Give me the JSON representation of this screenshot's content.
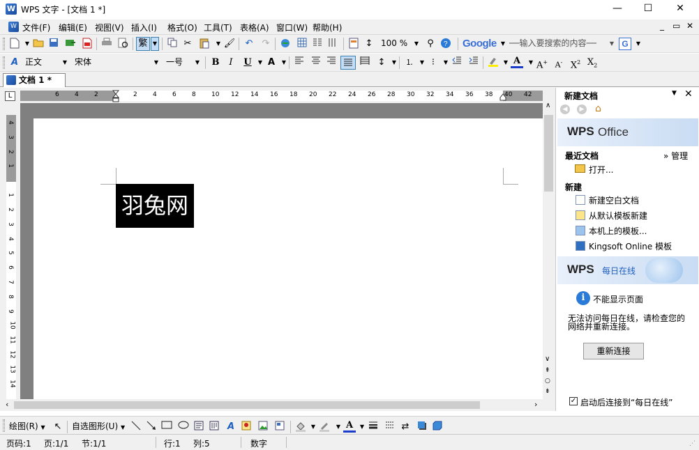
{
  "window": {
    "title": "WPS 文字 - [文档 1 *]",
    "minimize": "—",
    "maximize": "☐",
    "close": "✕"
  },
  "menu": {
    "items": [
      "文件(F)",
      "编辑(E)",
      "视图(V)",
      "插入(I)",
      "格式(O)",
      "工具(T)",
      "表格(A)",
      "窗口(W)",
      "帮助(H)"
    ],
    "mdi": [
      "_",
      "▭",
      "✕"
    ]
  },
  "toolbar": {
    "traditional_label": "繁",
    "zoom": "100 %",
    "google_logo": "Google",
    "search_placeholder": "──输入要搜索的内容──",
    "style": "正文",
    "font": "宋体",
    "size": "一号"
  },
  "doc_tab": {
    "label": "文档 1 *"
  },
  "ruler": {
    "h_ticks": [
      "6",
      "4",
      "2",
      "2",
      "4",
      "6",
      "8",
      "10",
      "12",
      "14",
      "16",
      "18",
      "20",
      "22",
      "24",
      "26",
      "28",
      "30",
      "32",
      "34",
      "36",
      "38",
      "40",
      "42"
    ],
    "v_ticks": [
      "4",
      "3",
      "2",
      "1",
      "1",
      "2",
      "3",
      "4",
      "5",
      "6",
      "7",
      "8",
      "9",
      "10",
      "11",
      "12",
      "13",
      "14"
    ]
  },
  "document": {
    "textbox_text": "羽兔网"
  },
  "task_pane": {
    "title": "新建文档",
    "wps_logo": "WPS",
    "office_label": "Office",
    "recent_heading": "最近文档",
    "manage_link": "» 管理",
    "open_link": "打开...",
    "new_heading": "新建",
    "new_blank": "新建空白文档",
    "new_from_default": "从默认模板新建",
    "local_templates": "本机上的模板...",
    "online_templates": "Kingsoft Online 模板",
    "daily_label": "每日在线",
    "cannot_display": "不能显示页面",
    "offline_message_line1": "无法访问每日在线，请检查您的",
    "offline_message_line2": "网络并重新连接。",
    "reconnect_button": "重新连接",
    "startup_checkbox_label": "启动后连接到“每日在线”",
    "startup_checked": true
  },
  "drawing_toolbar": {
    "draw_label": "绘图(R)",
    "autoshape_label": "自选图形(U)"
  },
  "status": {
    "page_number": "页码:1",
    "pages": "页:1/1",
    "section": "节:1/1",
    "line": "行:1",
    "column": "列:5",
    "mode": "数字"
  },
  "colors": {
    "font_color": "#1a3cc8",
    "highlight": "#ffee00",
    "page_bg": "#808080",
    "textbox_bg": "#000000"
  }
}
